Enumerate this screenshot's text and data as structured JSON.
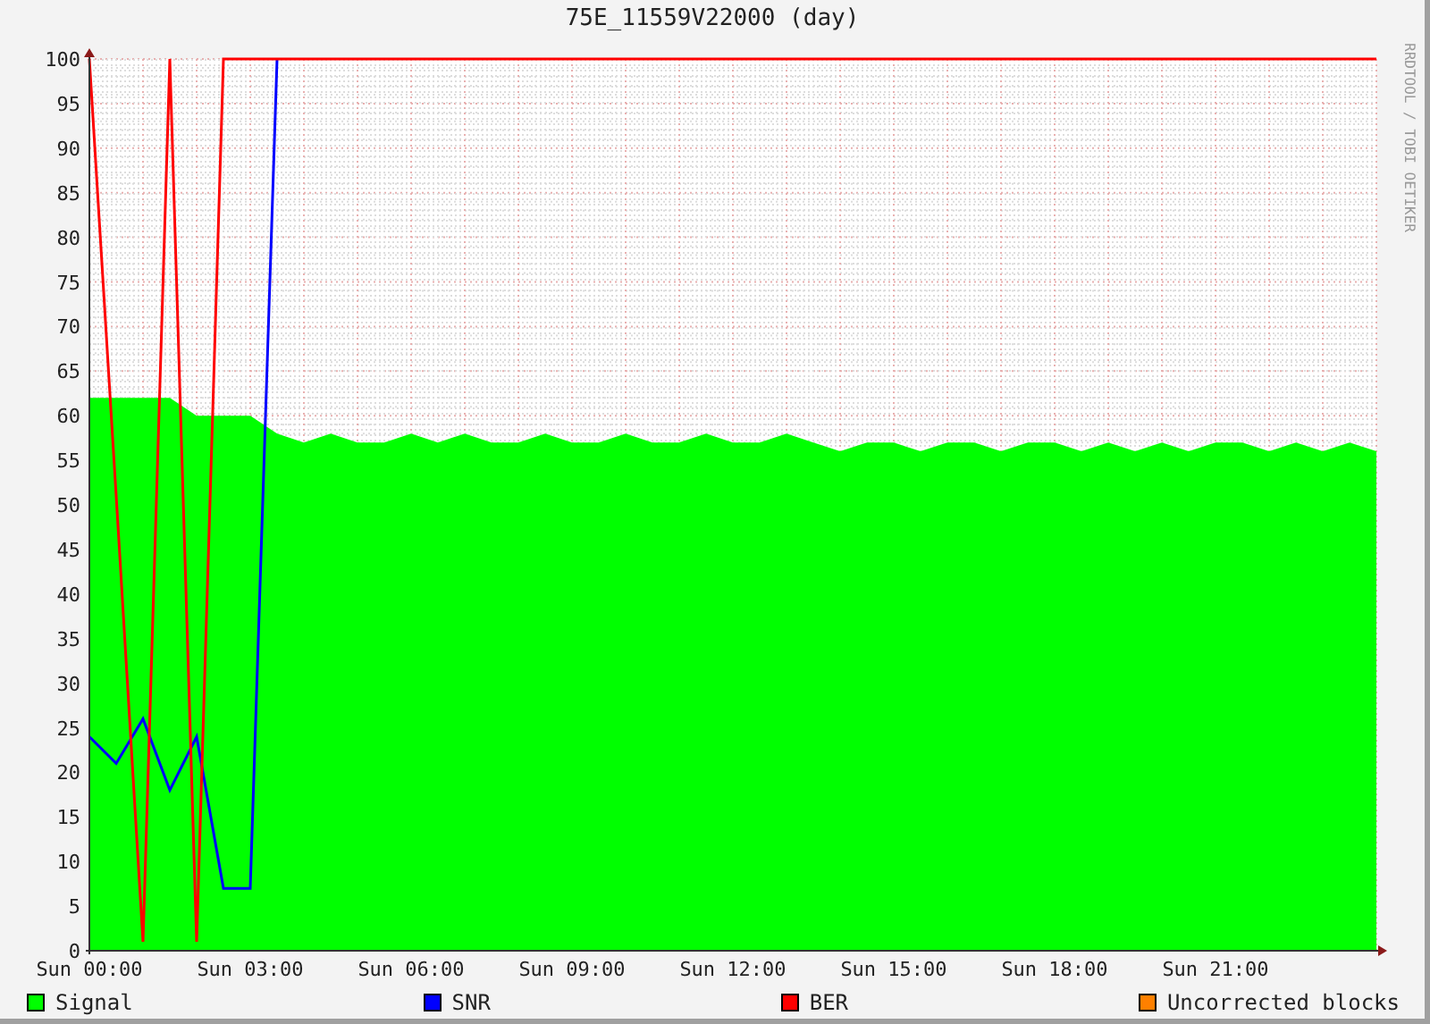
{
  "side_text": "RRDTOOL / TOBI OETIKER",
  "chart_data": {
    "type": "line",
    "title": "75E_11559V22000 (day)",
    "categories": [
      "Sun 00:00",
      null,
      null,
      null,
      null,
      null,
      "Sun 03:00",
      null,
      null,
      null,
      null,
      null,
      "Sun 06:00",
      null,
      null,
      null,
      null,
      null,
      "Sun 09:00",
      null,
      null,
      null,
      null,
      null,
      "Sun 12:00",
      null,
      null,
      null,
      null,
      null,
      "Sun 15:00",
      null,
      null,
      null,
      null,
      null,
      "Sun 18:00",
      null,
      null,
      null,
      null,
      null,
      "Sun 21:00",
      null,
      null,
      null,
      null,
      null,
      null
    ],
    "series": [
      {
        "name": "Signal",
        "color": "#00ff00",
        "type": "area",
        "values": [
          62,
          62,
          62,
          62,
          60,
          60,
          60,
          58,
          57,
          58,
          57,
          57,
          58,
          57,
          58,
          57,
          57,
          58,
          57,
          57,
          58,
          57,
          57,
          58,
          57,
          57,
          58,
          57,
          56,
          57,
          57,
          56,
          57,
          57,
          56,
          57,
          57,
          56,
          57,
          56,
          57,
          56,
          57,
          57,
          56,
          57,
          56,
          57,
          56
        ]
      },
      {
        "name": "SNR",
        "color": "#0000ff",
        "type": "line",
        "values": [
          24,
          21,
          26,
          18,
          24,
          7,
          7,
          100,
          null,
          null,
          null,
          null,
          null,
          null,
          null,
          null,
          null,
          null,
          null,
          null,
          null,
          null,
          null,
          null,
          null,
          null,
          null,
          null,
          null,
          null,
          null,
          null,
          null,
          null,
          null,
          null,
          null,
          null,
          null,
          null,
          null,
          null,
          null,
          null,
          null,
          null,
          null,
          null,
          null
        ]
      },
      {
        "name": "BER",
        "color": "#ff0000",
        "type": "line",
        "values": [
          100,
          51,
          1,
          100,
          1,
          100,
          100,
          100,
          100,
          100,
          100,
          100,
          100,
          100,
          100,
          100,
          100,
          100,
          100,
          100,
          100,
          100,
          100,
          100,
          100,
          100,
          100,
          100,
          100,
          100,
          100,
          100,
          100,
          100,
          100,
          100,
          100,
          100,
          100,
          100,
          100,
          100,
          100,
          100,
          100,
          100,
          100,
          100,
          100
        ]
      },
      {
        "name": "Uncorrected blocks",
        "color": "#ff8000",
        "type": "line",
        "values": [
          null,
          null,
          null,
          null,
          null,
          null,
          null,
          null,
          null,
          null,
          null,
          null,
          null,
          null,
          null,
          null,
          null,
          null,
          null,
          null,
          null,
          null,
          null,
          null,
          null,
          null,
          null,
          null,
          null,
          null,
          null,
          null,
          null,
          null,
          null,
          null,
          null,
          null,
          null,
          null,
          null,
          null,
          null,
          null,
          null,
          null,
          null,
          null,
          null
        ]
      }
    ],
    "ylim": [
      0,
      100
    ],
    "grid": true,
    "yticks": [
      0,
      5,
      10,
      15,
      20,
      25,
      30,
      35,
      40,
      45,
      50,
      55,
      60,
      65,
      70,
      75,
      80,
      85,
      90,
      95,
      100
    ]
  }
}
